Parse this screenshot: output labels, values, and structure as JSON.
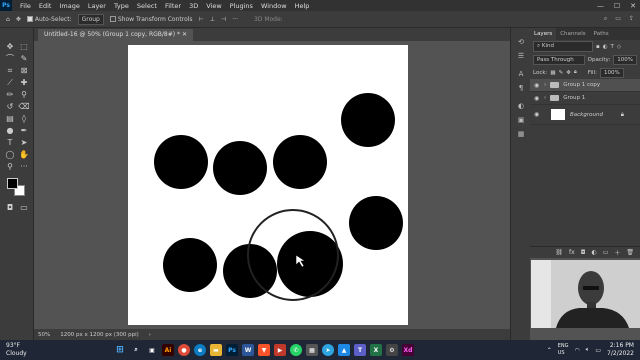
{
  "menubar": {
    "items": [
      "File",
      "Edit",
      "Image",
      "Layer",
      "Type",
      "Select",
      "Filter",
      "3D",
      "View",
      "Plugins",
      "Window",
      "Help"
    ]
  },
  "options": {
    "auto_select_label": "Auto-Select:",
    "target": "Group",
    "transform_label": "Show Transform Controls",
    "mode_3d": "3D Mode:"
  },
  "document": {
    "tab_title": "Untitled-16 @ 50% (Group 1 copy, RGB/8#) *"
  },
  "status": {
    "zoom": "50%",
    "doc_size": "1200 px x 1200 px (300 ppi)"
  },
  "panels": {
    "tabs": [
      "Layers",
      "Channels",
      "Paths"
    ],
    "kind_label": "Kind",
    "blend_mode": "Pass Through",
    "opacity_label": "Opacity:",
    "opacity_value": "100%",
    "lock_label": "Lock:",
    "fill_label": "Fill:",
    "fill_value": "100%",
    "layers": [
      {
        "name": "Group 1 copy",
        "type": "group",
        "selected": true
      },
      {
        "name": "Group 1",
        "type": "group",
        "selected": false
      },
      {
        "name": "Background",
        "type": "image",
        "selected": false,
        "locked": true
      }
    ]
  },
  "taskbar": {
    "temperature": "93°F",
    "weather": "Cloudy",
    "language": "ENG\nUS",
    "time": "2:16 PM",
    "date": "7/2/2022",
    "apps": [
      "start",
      "search",
      "task-view",
      "illustrator",
      "chrome",
      "edge",
      "explorer",
      "photoshop",
      "word",
      "brave",
      "media",
      "whatsapp",
      "store",
      "telegram",
      "photos",
      "teams",
      "excel",
      "settings",
      "xd"
    ]
  },
  "colors": {
    "ps_blue": "#31a8ff",
    "chrome_dark": "#323232",
    "panel": "#3c3c3c",
    "canvas_bg": "#535353"
  }
}
